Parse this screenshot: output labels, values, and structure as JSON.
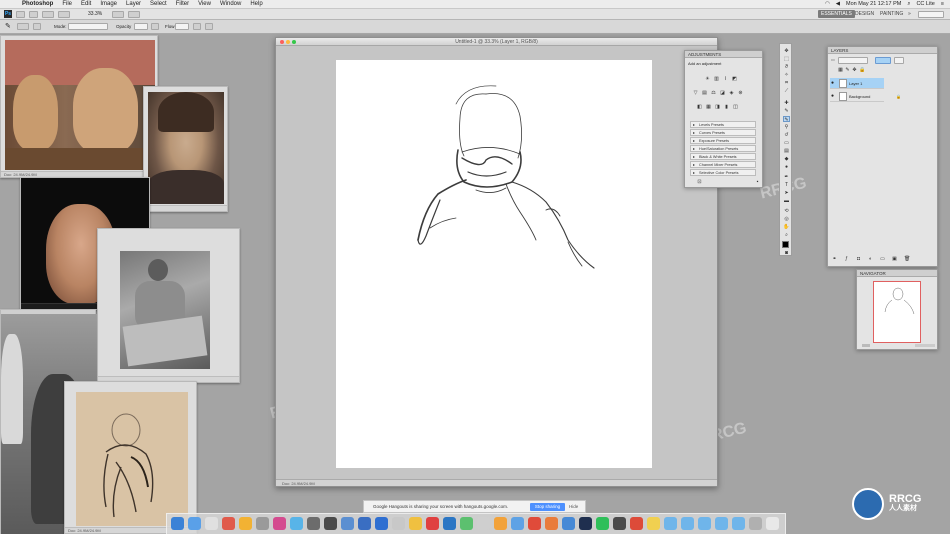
{
  "menubar": {
    "app": "Photoshop",
    "items": [
      "File",
      "Edit",
      "Image",
      "Layer",
      "Select",
      "Filter",
      "View",
      "Window",
      "Help"
    ],
    "clock": "Mon May 21 12:17 PM",
    "user": "CC Lite"
  },
  "options": {
    "zoom_value": "33.3%",
    "opacity_label": "Opacity",
    "flow_label": "Flow"
  },
  "workspaces": {
    "essentials": "ESSENTIALS",
    "design": "DESIGN",
    "painting": "PAINTING"
  },
  "document": {
    "title": "Untitled-1 @ 33.3% (Layer 1, RGB/8)",
    "status": "Doc: 24.9M/24.9M"
  },
  "adjustments": {
    "title": "ADJUSTMENTS",
    "subtitle": "Add an adjustment",
    "presets": [
      "Levels Presets",
      "Curves Presets",
      "Exposure Presets",
      "Hue/Saturation Presets",
      "Black & White Presets",
      "Channel Mixer Presets",
      "Selective Color Presets"
    ]
  },
  "layers": {
    "title": "LAYERS",
    "items": [
      {
        "name": "Layer 1"
      },
      {
        "name": "Background"
      }
    ]
  },
  "navigator": {
    "title": "NAVIGATOR"
  },
  "photos": [
    {
      "status": "Doc: 24.9M/24.9M"
    },
    {
      "status": ""
    },
    {
      "status": ""
    },
    {
      "status": ""
    },
    {
      "status": "Doc: 24.9M/24.9M"
    }
  ],
  "hangouts": {
    "message": "Google Hangouts is sharing your screen with hangouts.google.com.",
    "stop_label": "Stop sharing",
    "hide_label": "Hide"
  },
  "dock": {
    "colors": [
      "#3b82d6",
      "#5aa0e8",
      "#e0e0e0",
      "#e05a4b",
      "#f2b233",
      "#9a9a9a",
      "#d44b8f",
      "#58b4e8",
      "#6c6c6c",
      "#4a4a4a",
      "#5b8fd1",
      "#3a6ec2",
      "#2f6fd1",
      "#c8c8c8",
      "#f0c040",
      "#e04040",
      "#2b76c4",
      "#5cc06f",
      "#cfcfcf",
      "#f2a23a",
      "#5ea2e5",
      "#e04b3a",
      "#e97c3b",
      "#4689d6",
      "#1f2f4f",
      "#2fbf5a",
      "#4b4b4b",
      "#dd4b39",
      "#f0d050",
      "#6fb5ea",
      "#6fb5ea",
      "#6fb5ea",
      "#6fb5ea",
      "#6fb5ea",
      "#b0b0b0",
      "#e8e8e8"
    ]
  },
  "watermark": {
    "text": "RRCG",
    "text_cn": "人人素材",
    "logo_cn": "人人素材"
  }
}
